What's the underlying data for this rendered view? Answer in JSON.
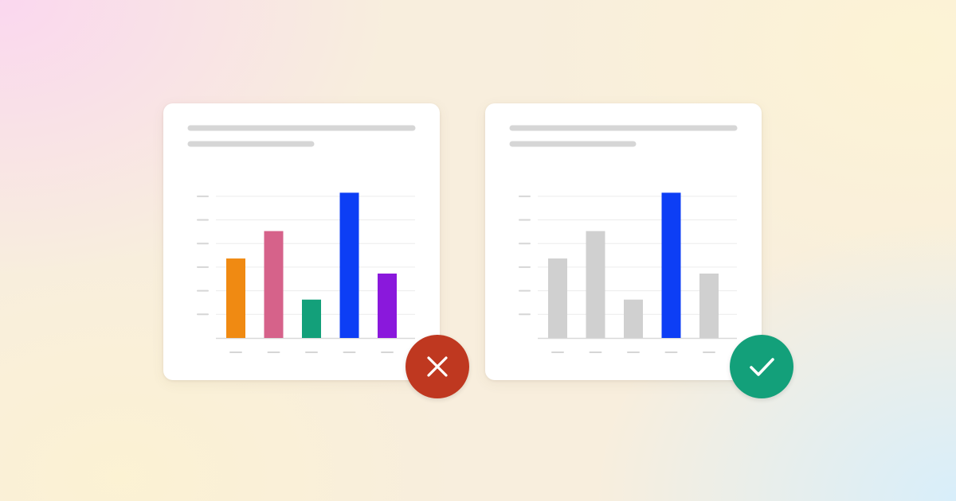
{
  "colors": {
    "placeholder": "#d6d6d6",
    "gridline": "#ececec",
    "axis": "#d9d9d9",
    "muted_bar": "#d0d0d0",
    "highlight_bar": "#0d3ef5",
    "bad_badge": "#bf3820",
    "good_badge": "#13a07a",
    "badge_icon": "#ffffff"
  },
  "badges": {
    "bad": {
      "icon": "close-icon",
      "meaning": "incorrect"
    },
    "good": {
      "icon": "checkmark-icon",
      "meaning": "correct"
    }
  },
  "chart_data": [
    {
      "type": "bar",
      "panel": "left",
      "title": "",
      "xlabel": "",
      "ylabel": "",
      "categories": [
        "",
        "",
        "",
        "",
        ""
      ],
      "values": [
        2.9,
        3.9,
        1.4,
        5.3,
        2.35
      ],
      "ylim": [
        0,
        5.6
      ],
      "yticks": 6,
      "grid": true,
      "bar_colors": [
        "#f08a12",
        "#d6628a",
        "#13a07a",
        "#0d3ef5",
        "#8a18dc"
      ]
    },
    {
      "type": "bar",
      "panel": "right",
      "title": "",
      "xlabel": "",
      "ylabel": "",
      "categories": [
        "",
        "",
        "",
        "",
        ""
      ],
      "values": [
        2.9,
        3.9,
        1.4,
        5.3,
        2.35
      ],
      "ylim": [
        0,
        5.6
      ],
      "yticks": 6,
      "grid": true,
      "highlight_index": 3,
      "bar_colors": [
        "#d0d0d0",
        "#d0d0d0",
        "#d0d0d0",
        "#0d3ef5",
        "#d0d0d0"
      ]
    }
  ]
}
